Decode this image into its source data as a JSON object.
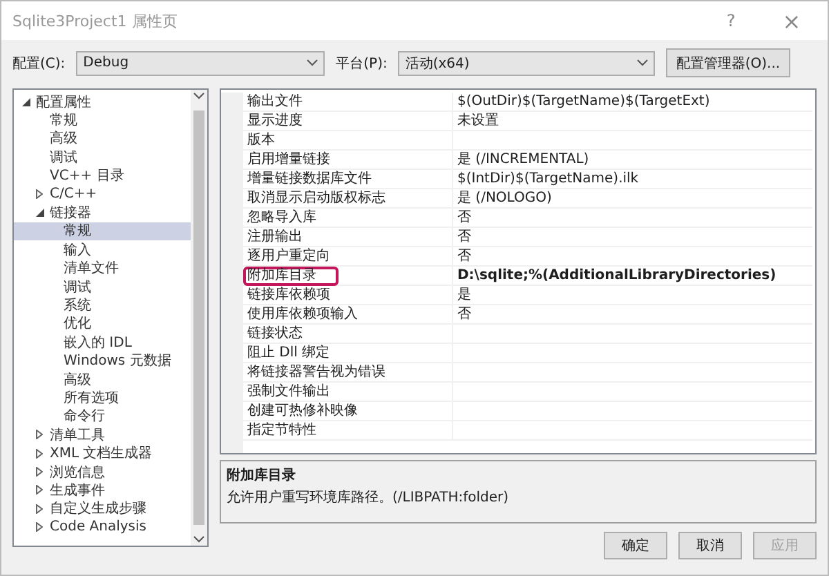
{
  "window": {
    "title": "Sqlite3Project1 属性页",
    "help": "?",
    "close": "×"
  },
  "toolbar": {
    "config_label": "配置(C):",
    "config_value": "Debug",
    "platform_label": "平台(P):",
    "platform_value": "活动(x64)",
    "manager_button": "配置管理器(O)..."
  },
  "tree": [
    {
      "label": "配置属性",
      "expanded": true,
      "selected": false,
      "children": [
        {
          "label": "常规",
          "selected": false
        },
        {
          "label": "高级",
          "selected": false
        },
        {
          "label": "调试",
          "selected": false
        },
        {
          "label": "VC++ 目录",
          "selected": false
        },
        {
          "label": "C/C++",
          "expanded": false,
          "selected": false
        },
        {
          "label": "链接器",
          "expanded": true,
          "selected": false,
          "children": [
            {
              "label": "常规",
              "selected": true
            },
            {
              "label": "输入",
              "selected": false
            },
            {
              "label": "清单文件",
              "selected": false
            },
            {
              "label": "调试",
              "selected": false
            },
            {
              "label": "系统",
              "selected": false
            },
            {
              "label": "优化",
              "selected": false
            },
            {
              "label": "嵌入的 IDL",
              "selected": false
            },
            {
              "label": "Windows 元数据",
              "selected": false
            },
            {
              "label": "高级",
              "selected": false
            },
            {
              "label": "所有选项",
              "selected": false
            },
            {
              "label": "命令行",
              "selected": false
            }
          ]
        },
        {
          "label": "清单工具",
          "expanded": false,
          "selected": false
        },
        {
          "label": "XML 文档生成器",
          "expanded": false,
          "selected": false
        },
        {
          "label": "浏览信息",
          "expanded": false,
          "selected": false
        },
        {
          "label": "生成事件",
          "expanded": false,
          "selected": false
        },
        {
          "label": "自定义生成步骤",
          "expanded": false,
          "selected": false
        },
        {
          "label": "Code Analysis",
          "expanded": false,
          "selected": false
        }
      ]
    }
  ],
  "properties": [
    {
      "name": "输出文件",
      "value": "$(OutDir)$(TargetName)$(TargetExt)",
      "bold": false,
      "highlighted": false
    },
    {
      "name": "显示进度",
      "value": "未设置",
      "bold": false,
      "highlighted": false
    },
    {
      "name": "版本",
      "highlighted": false
    },
    {
      "name": "启用增量链接",
      "value": "是 (/INCREMENTAL)",
      "bold": false,
      "highlighted": false
    },
    {
      "name": "增量链接数据库文件",
      "value": "$(IntDir)$(TargetName).ilk",
      "bold": false,
      "highlighted": false
    },
    {
      "name": "取消显示启动版权标志",
      "value": "是 (/NOLOGO)",
      "bold": false,
      "highlighted": false
    },
    {
      "name": "忽略导入库",
      "value": "否",
      "bold": false,
      "highlighted": false
    },
    {
      "name": "注册输出",
      "value": "否",
      "bold": false,
      "highlighted": false
    },
    {
      "name": "逐用户重定向",
      "value": "否",
      "bold": false,
      "highlighted": false
    },
    {
      "name": "附加库目录",
      "value": "D:\\sqlite;%(AdditionalLibraryDirectories)",
      "bold": true,
      "highlighted": true
    },
    {
      "name": "链接库依赖项",
      "value": "是",
      "bold": false,
      "highlighted": false
    },
    {
      "name": "使用库依赖项输入",
      "value": "否",
      "bold": false,
      "highlighted": false
    },
    {
      "name": "链接状态",
      "highlighted": false
    },
    {
      "name": "阻止 Dll 绑定",
      "highlighted": false
    },
    {
      "name": "将链接器警告视为错误",
      "highlighted": false
    },
    {
      "name": "强制文件输出",
      "highlighted": false
    },
    {
      "name": "创建可热修补映像",
      "highlighted": false
    },
    {
      "name": "指定节特性",
      "highlighted": false
    }
  ],
  "description": {
    "title": "附加库目录",
    "text": "允许用户重写环境库路径。(/LIBPATH:folder)"
  },
  "buttons": [
    {
      "label": "确定",
      "disabled": false
    },
    {
      "label": "取消",
      "disabled": false
    },
    {
      "label": "应用",
      "disabled": true
    }
  ]
}
